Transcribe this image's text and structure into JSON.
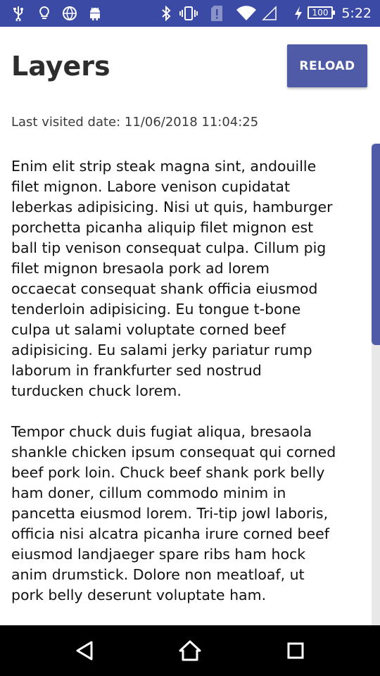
{
  "status_bar": {
    "time": "5:22",
    "battery_level": "100",
    "icons": [
      "usb-icon",
      "lightbulb-icon",
      "globe-icon",
      "android-icon",
      "bluetooth-icon",
      "vibrate-icon",
      "sim-alert-icon",
      "wifi-icon",
      "signal-icon",
      "charging-icon"
    ],
    "background_color": "#3b4aa5"
  },
  "header": {
    "title": "Layers",
    "reload_label": "RELOAD",
    "accent_color": "#4f5ba7"
  },
  "last_visited": "Last visited date: 11/06/2018 11:04:25",
  "content": {
    "paragraphs": [
      "Enim elit strip steak magna sint, andouille filet mignon.  Labore venison cupidatat leberkas adipisicing.  Nisi ut quis, hamburger porchetta picanha aliquip filet mignon est ball tip venison consequat culpa.  Cillum pig filet mignon bresaola pork ad lorem occaecat consequat shank officia eiusmod tenderloin adipisicing.  Eu tongue t-bone culpa ut salami voluptate corned beef adipisicing.  Eu salami jerky pariatur rump laborum in frankfurter sed nostrud turducken chuck lorem.",
      "Tempor chuck duis fugiat aliqua, bresaola shankle chicken ipsum consequat qui corned beef pork loin.  Chuck beef shank pork belly ham doner, cillum commodo minim in pancetta eiusmod lorem.  Tri-tip jowl laboris, officia nisi alcatra picanha irure corned beef eiusmod landjaeger spare ribs ham hock anim drumstick.  Dolore non meatloaf, ut pork belly deserunt voluptate ham."
    ]
  },
  "nav_bar": {
    "buttons": [
      "back-icon",
      "home-icon",
      "recents-icon"
    ]
  }
}
